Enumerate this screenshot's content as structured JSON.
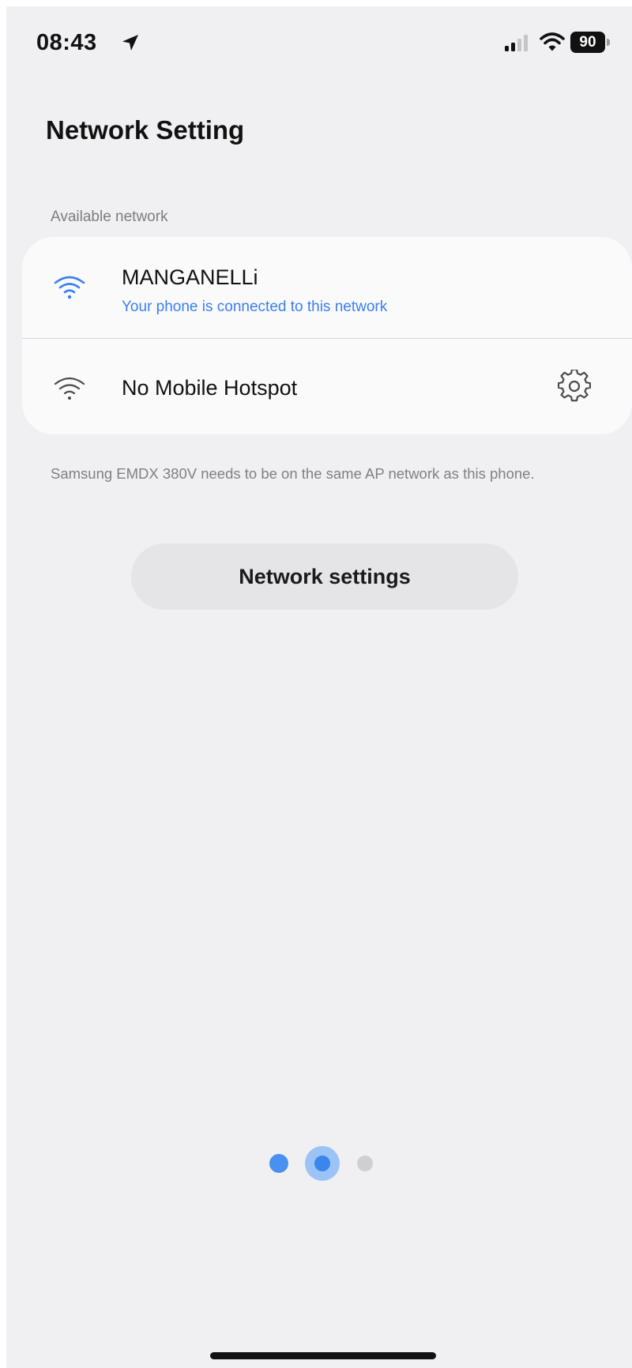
{
  "status_bar": {
    "time": "08:43",
    "battery_level": "90",
    "icons": [
      "location-arrow-icon",
      "cellular-signal-icon",
      "wifi-icon",
      "battery-icon"
    ]
  },
  "header": {
    "title": "Network Setting"
  },
  "networks": {
    "section_label": "Available network",
    "items": [
      {
        "name": "MANGANELLi",
        "status": "Your phone is connected to this network",
        "icon": "wifi-icon",
        "connected": true
      },
      {
        "name": "No Mobile Hotspot",
        "icon": "wifi-icon",
        "action_icon": "gear-icon",
        "connected": false
      }
    ]
  },
  "info": {
    "text": "Samsung EMDX 380V needs to be on the same AP network as this phone."
  },
  "actions": {
    "network_settings_label": "Network settings"
  },
  "pager": {
    "total_pages": 3,
    "current_page": 2
  },
  "colors": {
    "accent": "#3a7ff0",
    "background": "#f0f0f3",
    "card": "#fafafb"
  }
}
